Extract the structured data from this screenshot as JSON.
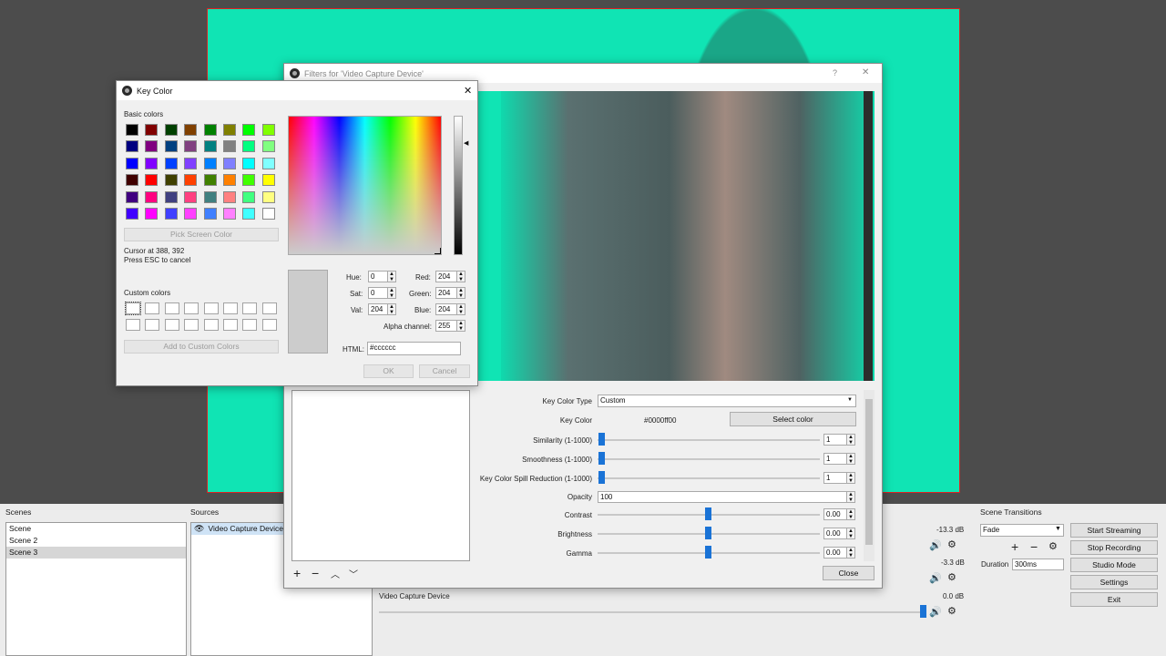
{
  "colors": {
    "green_screen": "#10e4b4",
    "accent": "#1a73d6",
    "preview_bg": "#4c4c4c"
  },
  "scenes": {
    "title": "Scenes",
    "items": [
      "Scene",
      "Scene 2",
      "Scene 3"
    ],
    "selected": 2
  },
  "sources": {
    "title": "Sources",
    "items": [
      "Video Capture Device"
    ]
  },
  "mixer": {
    "rows": [
      {
        "db": "-13.3 dB"
      },
      {
        "db": "-3.3 dB"
      },
      {
        "name": "Video Capture Device",
        "db": "0.0 dB"
      }
    ]
  },
  "transitions": {
    "title": "Scene Transitions",
    "type": "Fade",
    "duration_label": "Duration",
    "duration": "300ms"
  },
  "controls": [
    "Start Streaming",
    "Stop Recording",
    "Studio Mode",
    "Settings",
    "Exit"
  ],
  "filters": {
    "title": "Filters for 'Video Capture Device'",
    "help": "?",
    "close_x": "✕",
    "props": {
      "key_color_type_label": "Key Color Type",
      "key_color_type": "Custom",
      "key_color_label": "Key Color",
      "key_color_value": "#0000ff00",
      "select_color": "Select color",
      "similarity_label": "Similarity (1-1000)",
      "similarity": "1",
      "smoothness_label": "Smoothness (1-1000)",
      "smoothness": "1",
      "spill_label": "Key Color Spill Reduction (1-1000)",
      "spill": "1",
      "opacity_label": "Opacity",
      "opacity": "100",
      "contrast_label": "Contrast",
      "contrast": "0.00",
      "brightness_label": "Brightness",
      "brightness": "0.00",
      "gamma_label": "Gamma",
      "gamma": "0.00"
    },
    "close_button": "Close"
  },
  "keycolor": {
    "title": "Key Color",
    "close_x": "✕",
    "basic_colors_label": "Basic colors",
    "basic_colors": [
      [
        "#000000",
        "#800000",
        "#004000",
        "#804000",
        "#008000",
        "#808000",
        "#00ff00",
        "#80ff00"
      ],
      [
        "#000080",
        "#800080",
        "#004080",
        "#804080",
        "#008080",
        "#808080",
        "#00ff80",
        "#80ff80"
      ],
      [
        "#0000ff",
        "#8000ff",
        "#0040ff",
        "#8040ff",
        "#0080ff",
        "#8080ff",
        "#00ffff",
        "#80ffff"
      ],
      [
        "#400000",
        "#ff0000",
        "#404000",
        "#ff4000",
        "#408000",
        "#ff8000",
        "#40ff00",
        "#ffff00"
      ],
      [
        "#400080",
        "#ff0080",
        "#404080",
        "#ff4080",
        "#408080",
        "#ff8080",
        "#40ff80",
        "#ffff80"
      ],
      [
        "#4000ff",
        "#ff00ff",
        "#4040ff",
        "#ff40ff",
        "#4080ff",
        "#ff80ff",
        "#40ffff",
        "#ffffff"
      ]
    ],
    "pick_screen_color": "Pick Screen Color",
    "cursor_text": "Cursor at 388, 392",
    "esc_text": "Press ESC to cancel",
    "custom_colors_label": "Custom colors",
    "add_custom": "Add to Custom Colors",
    "current_color": "#cccccc",
    "hue_label": "Hue:",
    "hue": "0",
    "sat_label": "Sat:",
    "sat": "0",
    "val_label": "Val:",
    "val": "204",
    "red_label": "Red:",
    "red": "204",
    "green_label": "Green:",
    "green": "204",
    "blue_label": "Blue:",
    "blue": "204",
    "alpha_label": "Alpha channel:",
    "alpha": "255",
    "html_label": "HTML:",
    "html": "#cccccc",
    "ok": "OK",
    "cancel": "Cancel"
  }
}
